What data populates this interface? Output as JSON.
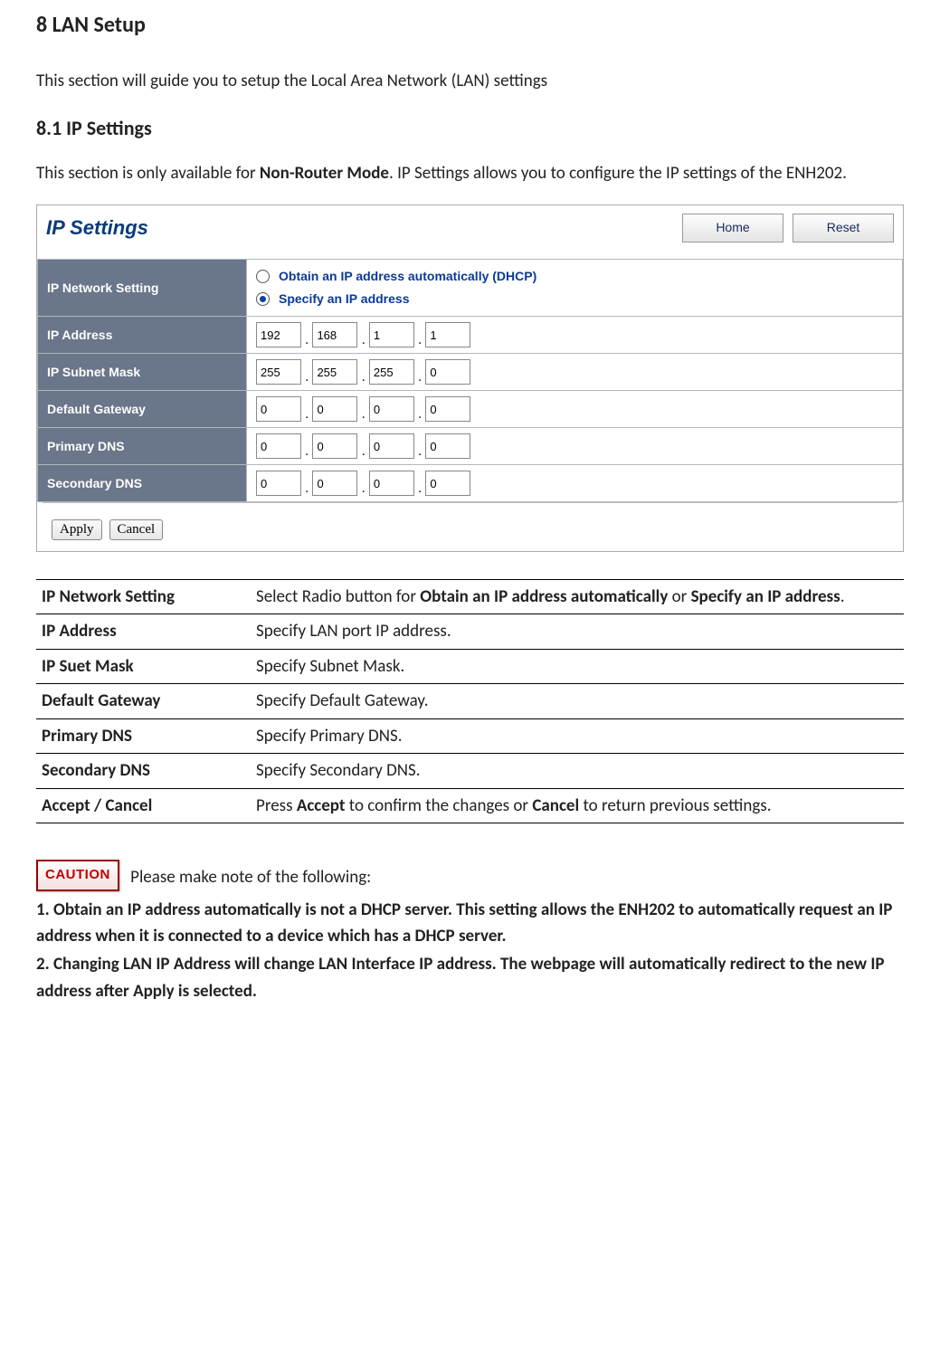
{
  "doc": {
    "h1": "8 LAN Setup",
    "intro": "This section will guide you to setup the Local Area Network (LAN) settings",
    "h2": "8.1 IP Settings",
    "sub_intro_pre": "This section is only available for ",
    "sub_intro_bold": "Non-Router Mode",
    "sub_intro_post": ". IP Settings allows you to configure the IP settings of the ENH202."
  },
  "ui": {
    "title": "IP Settings",
    "buttons": {
      "home": "Home",
      "reset": "Reset"
    },
    "rows": {
      "net_setting": "IP Network Setting",
      "ip_address": "IP Address",
      "subnet": "IP Subnet Mask",
      "gateway": "Default Gateway",
      "pdns": "Primary DNS",
      "sdns": "Secondary DNS"
    },
    "radios": {
      "dhcp": "Obtain an IP address automatically (DHCP)",
      "specify": "Specify an IP address",
      "selected": "specify"
    },
    "ip": [
      "192",
      "168",
      "1",
      "1"
    ],
    "mask": [
      "255",
      "255",
      "255",
      "0"
    ],
    "gateway": [
      "0",
      "0",
      "0",
      "0"
    ],
    "pdns": [
      "0",
      "0",
      "0",
      "0"
    ],
    "sdns": [
      "0",
      "0",
      "0",
      "0"
    ],
    "footer": {
      "apply": "Apply",
      "cancel": "Cancel"
    }
  },
  "desc": [
    {
      "label": "IP Network Setting",
      "text_pre": "Select Radio button for ",
      "b1": "Obtain an IP address automatically",
      "mid": " or ",
      "b2": "Specify an IP address",
      "post": "."
    },
    {
      "label": "IP Address",
      "text": "Specify LAN port IP address."
    },
    {
      "label": "IP Suet Mask",
      "text": "Specify Subnet Mask."
    },
    {
      "label": "Default Gateway",
      "text": "Specify Default Gateway."
    },
    {
      "label": "Primary DNS",
      "text": "Specify Primary DNS."
    },
    {
      "label": "Secondary DNS",
      "text": "Specify Secondary DNS."
    },
    {
      "label": "Accept / Cancel",
      "text_pre": "Press ",
      "b1": "Accept",
      "mid": " to confirm the changes or ",
      "b2": "Cancel",
      "post": " to return previous settings."
    }
  ],
  "caution": {
    "badge": "CAUTION",
    "lead": "Please make note of the following:",
    "items": [
      "1. Obtain an IP address automatically is not a DHCP server. This setting allows the ENH202 to automatically request an IP address when it is connected to a device which has a DHCP server.",
      "2. Changing LAN IP Address will change LAN Interface IP address. The webpage will automatically redirect to the new IP address after Apply is selected."
    ]
  }
}
